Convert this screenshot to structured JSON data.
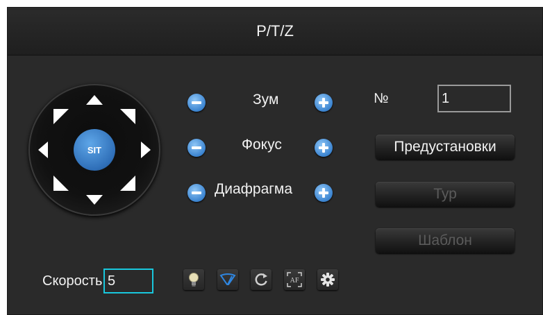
{
  "window": {
    "title": "P/T/Z"
  },
  "dial": {
    "center_label": "SIT"
  },
  "ptz_rows": [
    {
      "label": "Зум"
    },
    {
      "label": "Фокус"
    },
    {
      "label": "Диафрагма"
    }
  ],
  "preset": {
    "number_label": "№",
    "number_value": "1"
  },
  "buttons": {
    "presets": "Предустановки",
    "tour": "Тур",
    "pattern": "Шаблон"
  },
  "speed": {
    "label": "Скорость",
    "value": "5"
  },
  "toolbar_icons": [
    "light-bulb-icon",
    "wiper-icon",
    "rotate-icon",
    "autofocus-icon",
    "settings-gear-icon"
  ],
  "colors": {
    "accent": "#3b84d0",
    "focus_border": "#19c8de",
    "background": "#2a2a2a"
  }
}
